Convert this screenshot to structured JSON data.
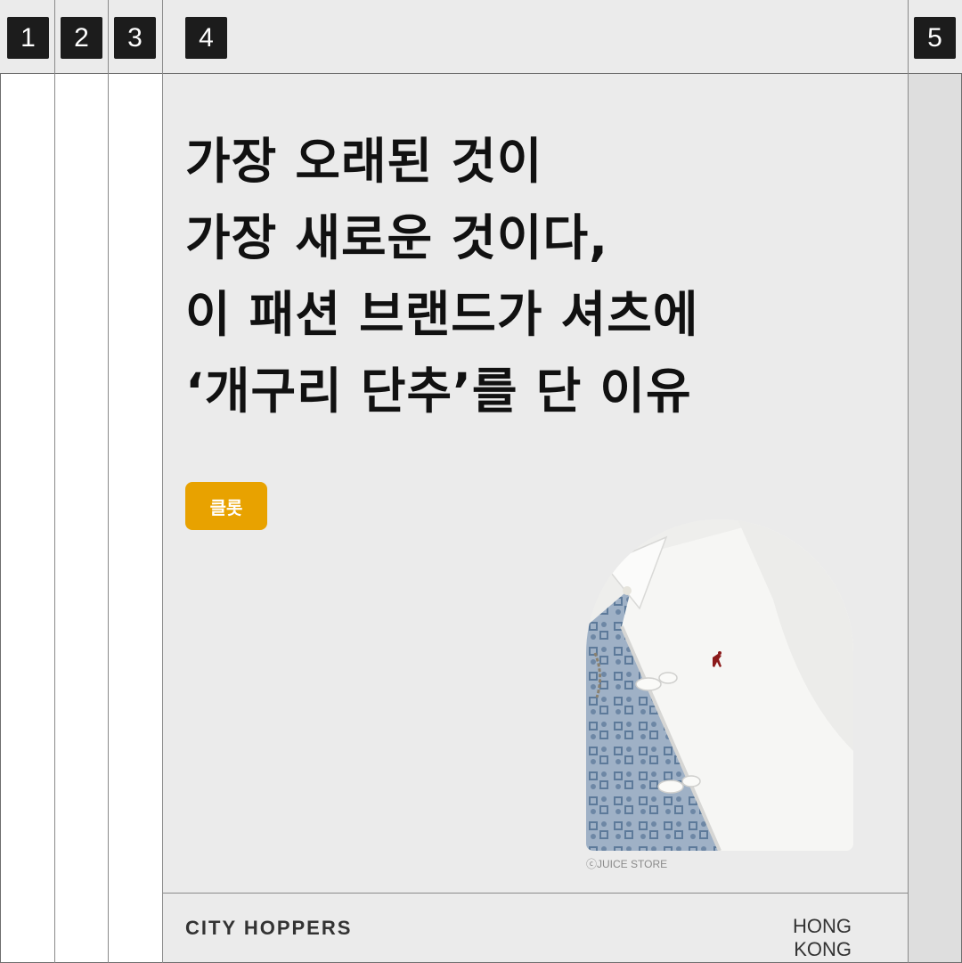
{
  "columns": {
    "badges": [
      "1",
      "2",
      "3",
      "4",
      "5"
    ]
  },
  "headline": {
    "lines": [
      "가장 오래된 것이",
      "가장 새로운 것이다,",
      "이 패션 브랜드가 셔츠에",
      "‘개구리 단추’를 단 이유"
    ]
  },
  "tag": {
    "label": "클롯"
  },
  "photo": {
    "credit": "ⓒJUICE STORE"
  },
  "footer": {
    "brand": "CITY HOPPERS",
    "region": "HONG KONG"
  },
  "colors": {
    "accent": "#e8a200",
    "background": "#ebebeb",
    "text": "#111111"
  }
}
